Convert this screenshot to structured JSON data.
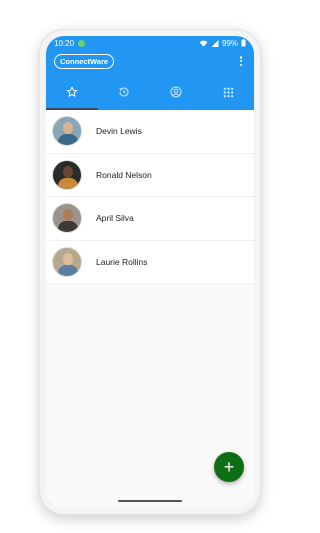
{
  "status_bar": {
    "time": "10:20",
    "battery": "99%"
  },
  "app": {
    "brand_label": "ConnectWare"
  },
  "tabs": [
    {
      "name": "favorites",
      "icon": "star-icon",
      "active": true
    },
    {
      "name": "recents",
      "icon": "history-icon",
      "active": false
    },
    {
      "name": "contacts",
      "icon": "person-icon",
      "active": false
    },
    {
      "name": "dialpad",
      "icon": "grid-icon",
      "active": false
    }
  ],
  "contacts": [
    {
      "name": "Devin Lewis"
    },
    {
      "name": "Ronald Nelson"
    },
    {
      "name": "April Silva"
    },
    {
      "name": "Laurie Rollins"
    }
  ],
  "fab": {
    "label": "+"
  },
  "colors": {
    "primary": "#2196f3",
    "fab": "#0d6e15"
  }
}
